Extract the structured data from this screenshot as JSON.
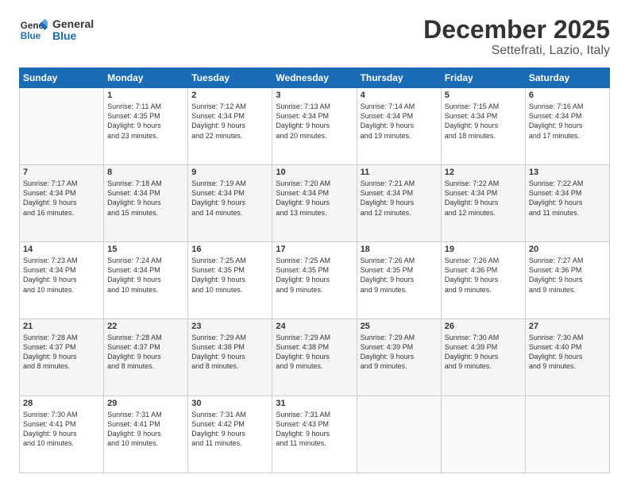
{
  "logo": {
    "line1": "General",
    "line2": "Blue"
  },
  "title": "December 2025",
  "location": "Settefrati, Lazio, Italy",
  "weekdays": [
    "Sunday",
    "Monday",
    "Tuesday",
    "Wednesday",
    "Thursday",
    "Friday",
    "Saturday"
  ],
  "weeks": [
    [
      {
        "day": "",
        "info": ""
      },
      {
        "day": "1",
        "info": "Sunrise: 7:11 AM\nSunset: 4:35 PM\nDaylight: 9 hours\nand 23 minutes."
      },
      {
        "day": "2",
        "info": "Sunrise: 7:12 AM\nSunset: 4:34 PM\nDaylight: 9 hours\nand 22 minutes."
      },
      {
        "day": "3",
        "info": "Sunrise: 7:13 AM\nSunset: 4:34 PM\nDaylight: 9 hours\nand 20 minutes."
      },
      {
        "day": "4",
        "info": "Sunrise: 7:14 AM\nSunset: 4:34 PM\nDaylight: 9 hours\nand 19 minutes."
      },
      {
        "day": "5",
        "info": "Sunrise: 7:15 AM\nSunset: 4:34 PM\nDaylight: 9 hours\nand 18 minutes."
      },
      {
        "day": "6",
        "info": "Sunrise: 7:16 AM\nSunset: 4:34 PM\nDaylight: 9 hours\nand 17 minutes."
      }
    ],
    [
      {
        "day": "7",
        "info": "Sunrise: 7:17 AM\nSunset: 4:34 PM\nDaylight: 9 hours\nand 16 minutes."
      },
      {
        "day": "8",
        "info": "Sunrise: 7:18 AM\nSunset: 4:34 PM\nDaylight: 9 hours\nand 15 minutes."
      },
      {
        "day": "9",
        "info": "Sunrise: 7:19 AM\nSunset: 4:34 PM\nDaylight: 9 hours\nand 14 minutes."
      },
      {
        "day": "10",
        "info": "Sunrise: 7:20 AM\nSunset: 4:34 PM\nDaylight: 9 hours\nand 13 minutes."
      },
      {
        "day": "11",
        "info": "Sunrise: 7:21 AM\nSunset: 4:34 PM\nDaylight: 9 hours\nand 12 minutes."
      },
      {
        "day": "12",
        "info": "Sunrise: 7:22 AM\nSunset: 4:34 PM\nDaylight: 9 hours\nand 12 minutes."
      },
      {
        "day": "13",
        "info": "Sunrise: 7:22 AM\nSunset: 4:34 PM\nDaylight: 9 hours\nand 11 minutes."
      }
    ],
    [
      {
        "day": "14",
        "info": "Sunrise: 7:23 AM\nSunset: 4:34 PM\nDaylight: 9 hours\nand 10 minutes."
      },
      {
        "day": "15",
        "info": "Sunrise: 7:24 AM\nSunset: 4:34 PM\nDaylight: 9 hours\nand 10 minutes."
      },
      {
        "day": "16",
        "info": "Sunrise: 7:25 AM\nSunset: 4:35 PM\nDaylight: 9 hours\nand 10 minutes."
      },
      {
        "day": "17",
        "info": "Sunrise: 7:25 AM\nSunset: 4:35 PM\nDaylight: 9 hours\nand 9 minutes."
      },
      {
        "day": "18",
        "info": "Sunrise: 7:26 AM\nSunset: 4:35 PM\nDaylight: 9 hours\nand 9 minutes."
      },
      {
        "day": "19",
        "info": "Sunrise: 7:26 AM\nSunset: 4:36 PM\nDaylight: 9 hours\nand 9 minutes."
      },
      {
        "day": "20",
        "info": "Sunrise: 7:27 AM\nSunset: 4:36 PM\nDaylight: 9 hours\nand 9 minutes."
      }
    ],
    [
      {
        "day": "21",
        "info": "Sunrise: 7:28 AM\nSunset: 4:37 PM\nDaylight: 9 hours\nand 8 minutes."
      },
      {
        "day": "22",
        "info": "Sunrise: 7:28 AM\nSunset: 4:37 PM\nDaylight: 9 hours\nand 8 minutes."
      },
      {
        "day": "23",
        "info": "Sunrise: 7:29 AM\nSunset: 4:38 PM\nDaylight: 9 hours\nand 8 minutes."
      },
      {
        "day": "24",
        "info": "Sunrise: 7:29 AM\nSunset: 4:38 PM\nDaylight: 9 hours\nand 9 minutes."
      },
      {
        "day": "25",
        "info": "Sunrise: 7:29 AM\nSunset: 4:39 PM\nDaylight: 9 hours\nand 9 minutes."
      },
      {
        "day": "26",
        "info": "Sunrise: 7:30 AM\nSunset: 4:39 PM\nDaylight: 9 hours\nand 9 minutes."
      },
      {
        "day": "27",
        "info": "Sunrise: 7:30 AM\nSunset: 4:40 PM\nDaylight: 9 hours\nand 9 minutes."
      }
    ],
    [
      {
        "day": "28",
        "info": "Sunrise: 7:30 AM\nSunset: 4:41 PM\nDaylight: 9 hours\nand 10 minutes."
      },
      {
        "day": "29",
        "info": "Sunrise: 7:31 AM\nSunset: 4:41 PM\nDaylight: 9 hours\nand 10 minutes."
      },
      {
        "day": "30",
        "info": "Sunrise: 7:31 AM\nSunset: 4:42 PM\nDaylight: 9 hours\nand 11 minutes."
      },
      {
        "day": "31",
        "info": "Sunrise: 7:31 AM\nSunset: 4:43 PM\nDaylight: 9 hours\nand 11 minutes."
      },
      {
        "day": "",
        "info": ""
      },
      {
        "day": "",
        "info": ""
      },
      {
        "day": "",
        "info": ""
      }
    ]
  ]
}
